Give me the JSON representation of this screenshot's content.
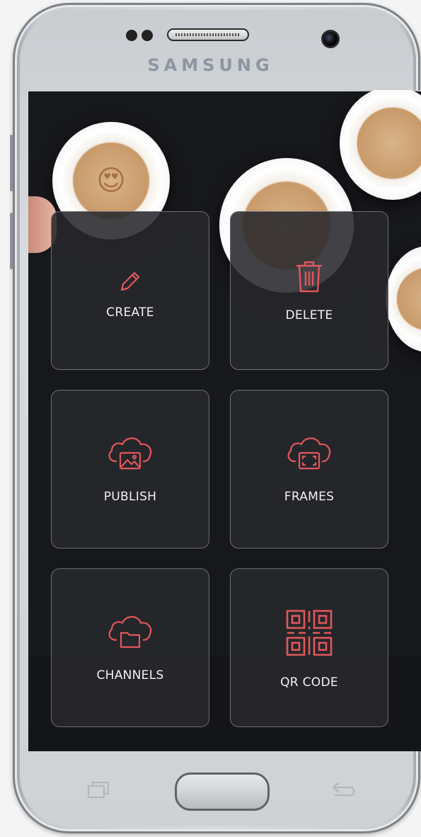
{
  "device": {
    "brand": "SAMSUNG"
  },
  "menu": {
    "tiles": [
      {
        "label": "CREATE",
        "icon": "pencil-icon"
      },
      {
        "label": "DELETE",
        "icon": "trash-icon"
      },
      {
        "label": "PUBLISH",
        "icon": "cloud-image-icon"
      },
      {
        "label": "FRAMES",
        "icon": "cloud-frame-icon"
      },
      {
        "label": "CHANNELS",
        "icon": "cloud-folder-icon"
      },
      {
        "label": "QR CODE",
        "icon": "qr-code-icon"
      }
    ]
  },
  "colors": {
    "accent": "#e0575b",
    "tile_bg": "#28282c",
    "screen_bg": "#17181c"
  }
}
